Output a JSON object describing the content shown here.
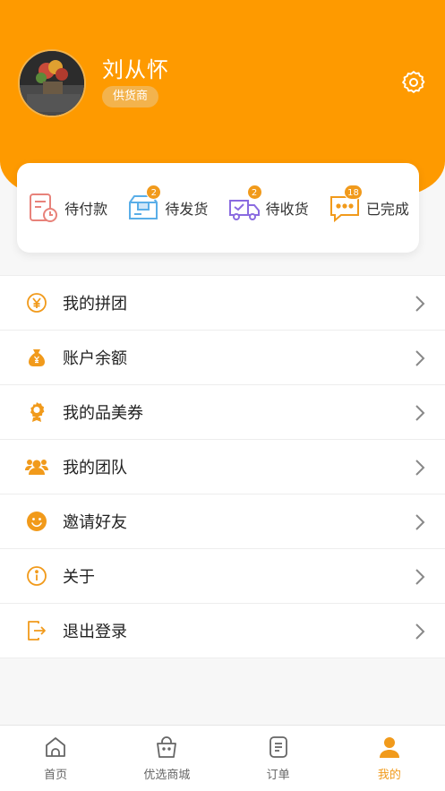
{
  "profile": {
    "name": "刘从怀",
    "role": "供货商"
  },
  "orders": [
    {
      "label": "待付款",
      "icon": "pending-payment-icon",
      "badge": ""
    },
    {
      "label": "待发货",
      "icon": "pending-shipment-icon",
      "badge": "2"
    },
    {
      "label": "待收货",
      "icon": "pending-receipt-icon",
      "badge": "2"
    },
    {
      "label": "已完成",
      "icon": "completed-icon",
      "badge": "18"
    }
  ],
  "menu": [
    {
      "label": "我的拼团",
      "icon": "yen-circle-icon"
    },
    {
      "label": "账户余额",
      "icon": "money-bag-icon"
    },
    {
      "label": "我的品美券",
      "icon": "award-icon"
    },
    {
      "label": "我的团队",
      "icon": "team-icon"
    },
    {
      "label": "邀请好友",
      "icon": "smile-icon"
    },
    {
      "label": "关于",
      "icon": "info-icon"
    },
    {
      "label": "退出登录",
      "icon": "logout-icon"
    }
  ],
  "tabs": [
    {
      "label": "首页",
      "icon": "home-icon"
    },
    {
      "label": "优选商城",
      "icon": "shopping-bag-icon"
    },
    {
      "label": "订单",
      "icon": "order-list-icon"
    },
    {
      "label": "我的",
      "icon": "user-icon"
    }
  ],
  "colors": {
    "accent": "#fe9a00",
    "icon_orange": "#f19a1b",
    "icon_blue": "#5aaee8",
    "icon_purple": "#8a6be0",
    "icon_red": "#e8827a"
  }
}
